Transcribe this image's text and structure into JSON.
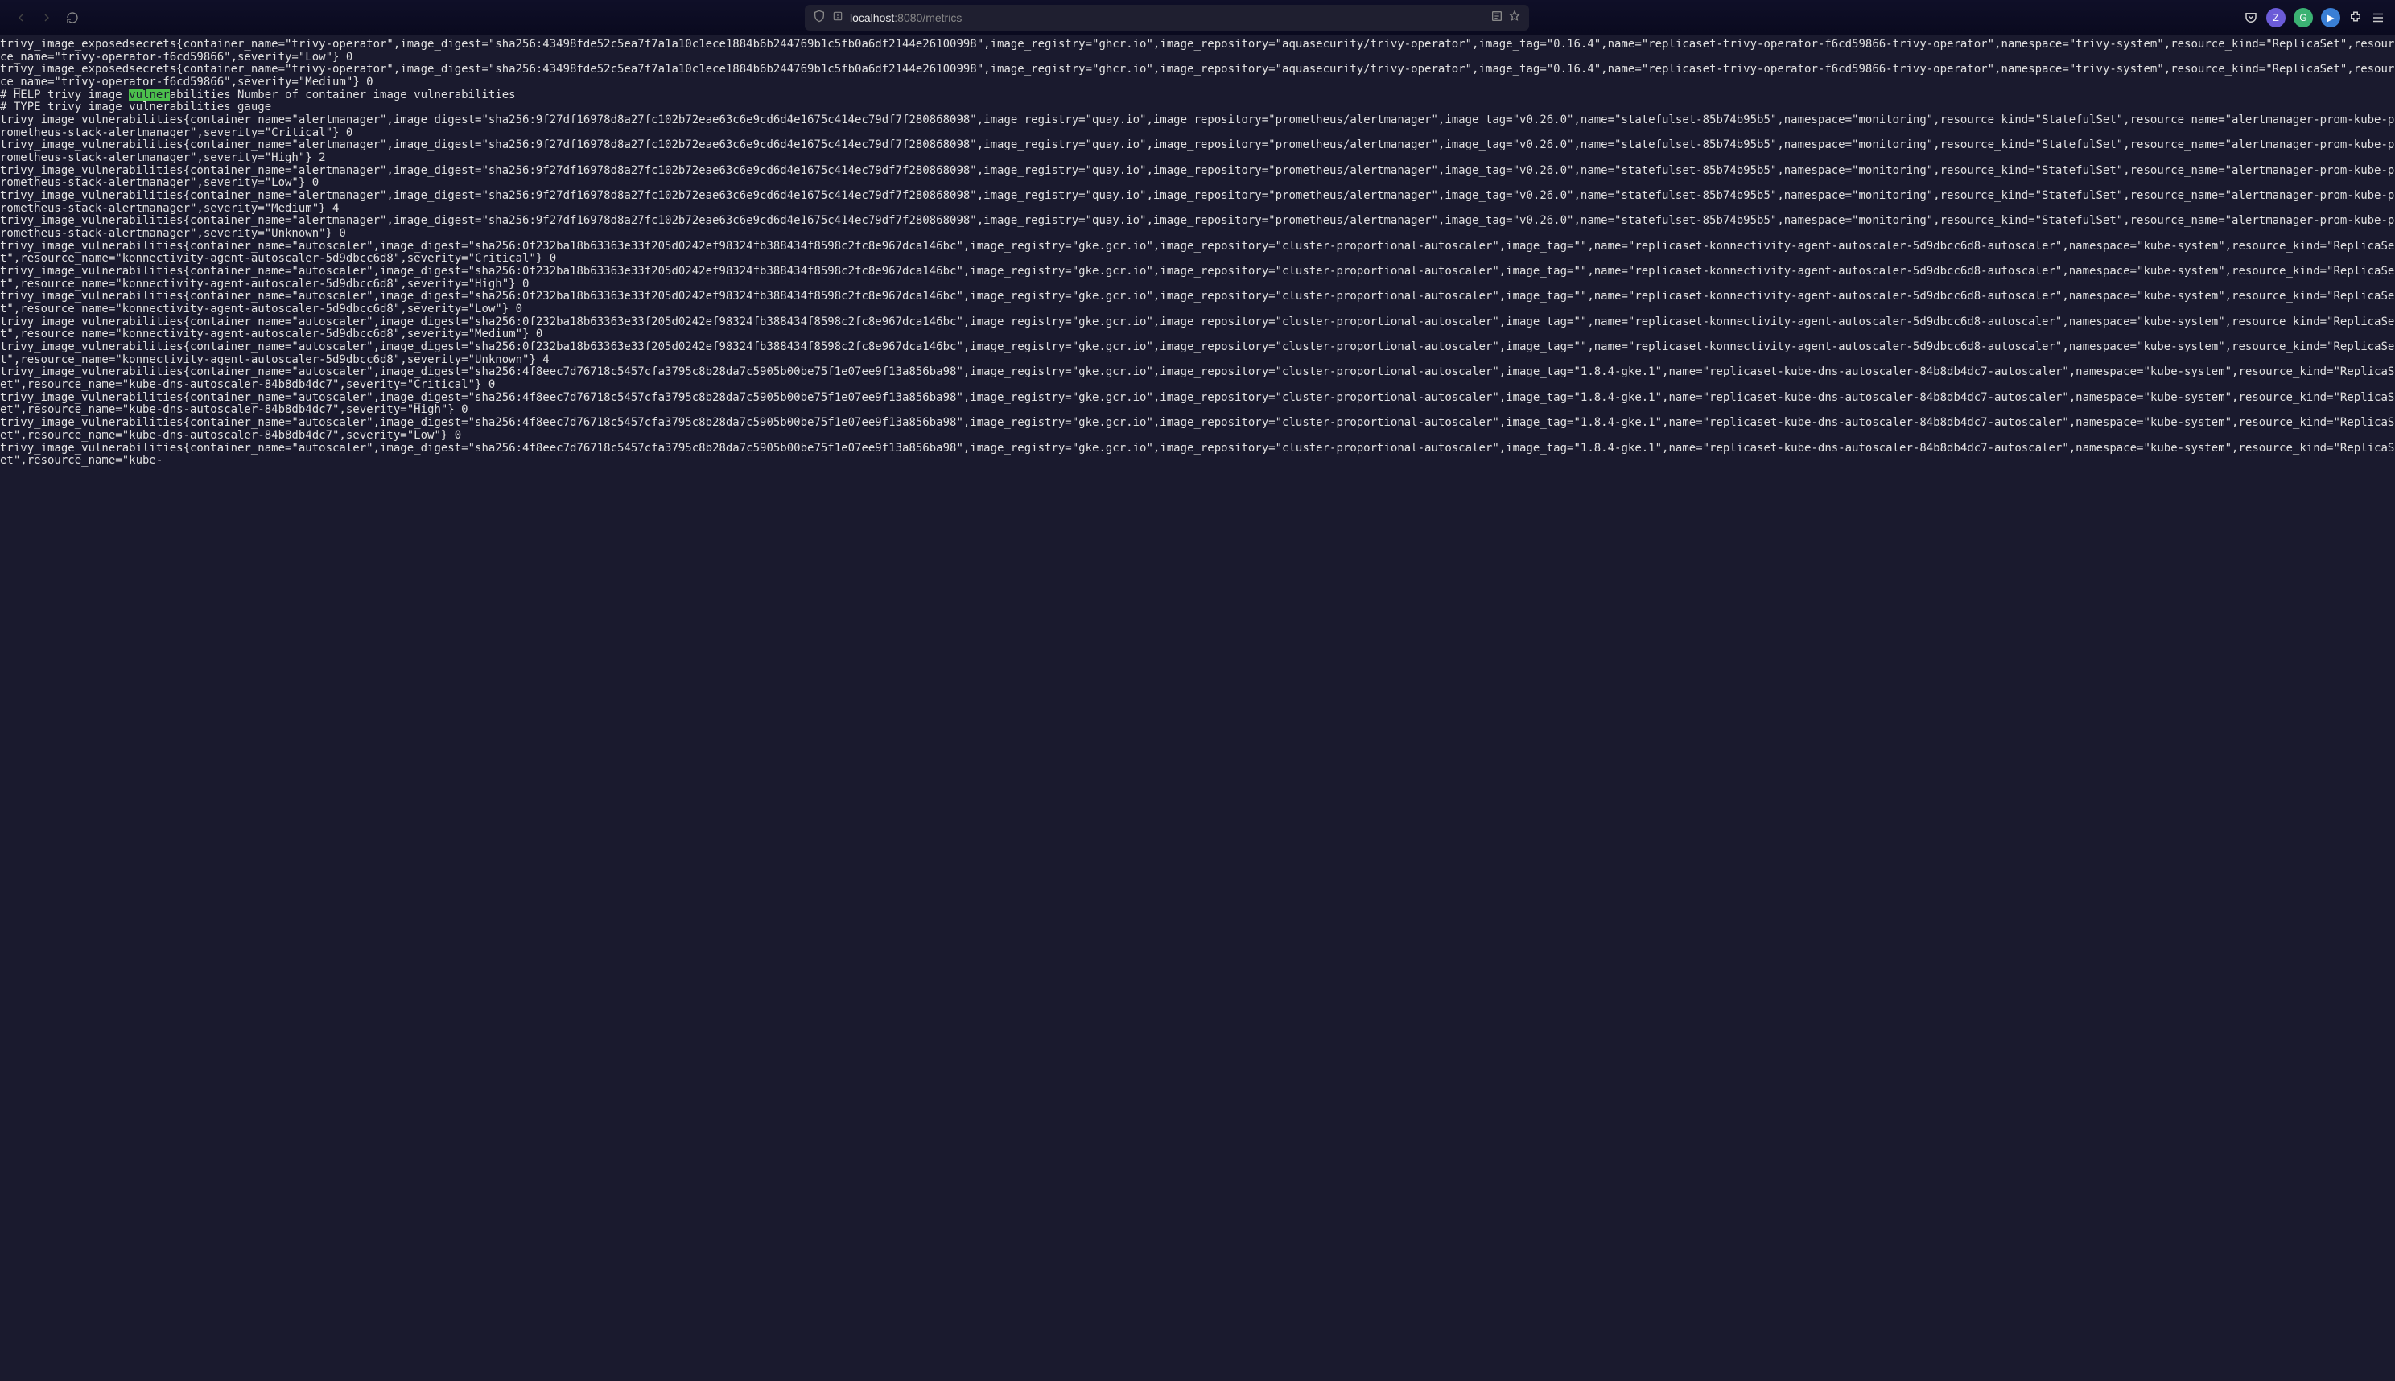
{
  "browser": {
    "url_host": "localhost",
    "url_port": ":8080",
    "url_path": "/metrics",
    "pill1_letter": "Z",
    "pill2_letter": "G",
    "pill3_symbol": "▶"
  },
  "highlight": "vulner",
  "metrics_lines": [
    "trivy_image_exposedsecrets{container_name=\"trivy-operator\",image_digest=\"sha256:43498fde52c5ea7f7a1a10c1ece1884b6b244769b1c5fb0a6df2144e26100998\",image_registry=\"ghcr.io\",image_repository=\"aquasecurity/trivy-operator\",image_tag=\"0.16.4\",name=\"replicaset-trivy-operator-f6cd59866-trivy-operator\",namespace=\"trivy-system\",resource_kind=\"ReplicaSet\",resource_name=\"trivy-operator-f6cd59866\",severity=\"Low\"} 0",
    "trivy_image_exposedsecrets{container_name=\"trivy-operator\",image_digest=\"sha256:43498fde52c5ea7f7a1a10c1ece1884b6b244769b1c5fb0a6df2144e26100998\",image_registry=\"ghcr.io\",image_repository=\"aquasecurity/trivy-operator\",image_tag=\"0.16.4\",name=\"replicaset-trivy-operator-f6cd59866-trivy-operator\",namespace=\"trivy-system\",resource_kind=\"ReplicaSet\",resource_name=\"trivy-operator-f6cd59866\",severity=\"Medium\"} 0",
    "# HELP trivy_image_vulnerabilities Number of container image vulnerabilities",
    "# TYPE trivy_image_vulnerabilities gauge",
    "trivy_image_vulnerabilities{container_name=\"alertmanager\",image_digest=\"sha256:9f27df16978d8a27fc102b72eae63c6e9cd6d4e1675c414ec79df7f280868098\",image_registry=\"quay.io\",image_repository=\"prometheus/alertmanager\",image_tag=\"v0.26.0\",name=\"statefulset-85b74b95b5\",namespace=\"monitoring\",resource_kind=\"StatefulSet\",resource_name=\"alertmanager-prom-kube-prometheus-stack-alertmanager\",severity=\"Critical\"} 0",
    "trivy_image_vulnerabilities{container_name=\"alertmanager\",image_digest=\"sha256:9f27df16978d8a27fc102b72eae63c6e9cd6d4e1675c414ec79df7f280868098\",image_registry=\"quay.io\",image_repository=\"prometheus/alertmanager\",image_tag=\"v0.26.0\",name=\"statefulset-85b74b95b5\",namespace=\"monitoring\",resource_kind=\"StatefulSet\",resource_name=\"alertmanager-prom-kube-prometheus-stack-alertmanager\",severity=\"High\"} 2",
    "trivy_image_vulnerabilities{container_name=\"alertmanager\",image_digest=\"sha256:9f27df16978d8a27fc102b72eae63c6e9cd6d4e1675c414ec79df7f280868098\",image_registry=\"quay.io\",image_repository=\"prometheus/alertmanager\",image_tag=\"v0.26.0\",name=\"statefulset-85b74b95b5\",namespace=\"monitoring\",resource_kind=\"StatefulSet\",resource_name=\"alertmanager-prom-kube-prometheus-stack-alertmanager\",severity=\"Low\"} 0",
    "trivy_image_vulnerabilities{container_name=\"alertmanager\",image_digest=\"sha256:9f27df16978d8a27fc102b72eae63c6e9cd6d4e1675c414ec79df7f280868098\",image_registry=\"quay.io\",image_repository=\"prometheus/alertmanager\",image_tag=\"v0.26.0\",name=\"statefulset-85b74b95b5\",namespace=\"monitoring\",resource_kind=\"StatefulSet\",resource_name=\"alertmanager-prom-kube-prometheus-stack-alertmanager\",severity=\"Medium\"} 4",
    "trivy_image_vulnerabilities{container_name=\"alertmanager\",image_digest=\"sha256:9f27df16978d8a27fc102b72eae63c6e9cd6d4e1675c414ec79df7f280868098\",image_registry=\"quay.io\",image_repository=\"prometheus/alertmanager\",image_tag=\"v0.26.0\",name=\"statefulset-85b74b95b5\",namespace=\"monitoring\",resource_kind=\"StatefulSet\",resource_name=\"alertmanager-prom-kube-prometheus-stack-alertmanager\",severity=\"Unknown\"} 0",
    "trivy_image_vulnerabilities{container_name=\"autoscaler\",image_digest=\"sha256:0f232ba18b63363e33f205d0242ef98324fb388434f8598c2fc8e967dca146bc\",image_registry=\"gke.gcr.io\",image_repository=\"cluster-proportional-autoscaler\",image_tag=\"\",name=\"replicaset-konnectivity-agent-autoscaler-5d9dbcc6d8-autoscaler\",namespace=\"kube-system\",resource_kind=\"ReplicaSet\",resource_name=\"konnectivity-agent-autoscaler-5d9dbcc6d8\",severity=\"Critical\"} 0",
    "trivy_image_vulnerabilities{container_name=\"autoscaler\",image_digest=\"sha256:0f232ba18b63363e33f205d0242ef98324fb388434f8598c2fc8e967dca146bc\",image_registry=\"gke.gcr.io\",image_repository=\"cluster-proportional-autoscaler\",image_tag=\"\",name=\"replicaset-konnectivity-agent-autoscaler-5d9dbcc6d8-autoscaler\",namespace=\"kube-system\",resource_kind=\"ReplicaSet\",resource_name=\"konnectivity-agent-autoscaler-5d9dbcc6d8\",severity=\"High\"} 0",
    "trivy_image_vulnerabilities{container_name=\"autoscaler\",image_digest=\"sha256:0f232ba18b63363e33f205d0242ef98324fb388434f8598c2fc8e967dca146bc\",image_registry=\"gke.gcr.io\",image_repository=\"cluster-proportional-autoscaler\",image_tag=\"\",name=\"replicaset-konnectivity-agent-autoscaler-5d9dbcc6d8-autoscaler\",namespace=\"kube-system\",resource_kind=\"ReplicaSet\",resource_name=\"konnectivity-agent-autoscaler-5d9dbcc6d8\",severity=\"Low\"} 0",
    "trivy_image_vulnerabilities{container_name=\"autoscaler\",image_digest=\"sha256:0f232ba18b63363e33f205d0242ef98324fb388434f8598c2fc8e967dca146bc\",image_registry=\"gke.gcr.io\",image_repository=\"cluster-proportional-autoscaler\",image_tag=\"\",name=\"replicaset-konnectivity-agent-autoscaler-5d9dbcc6d8-autoscaler\",namespace=\"kube-system\",resource_kind=\"ReplicaSet\",resource_name=\"konnectivity-agent-autoscaler-5d9dbcc6d8\",severity=\"Medium\"} 0",
    "trivy_image_vulnerabilities{container_name=\"autoscaler\",image_digest=\"sha256:0f232ba18b63363e33f205d0242ef98324fb388434f8598c2fc8e967dca146bc\",image_registry=\"gke.gcr.io\",image_repository=\"cluster-proportional-autoscaler\",image_tag=\"\",name=\"replicaset-konnectivity-agent-autoscaler-5d9dbcc6d8-autoscaler\",namespace=\"kube-system\",resource_kind=\"ReplicaSet\",resource_name=\"konnectivity-agent-autoscaler-5d9dbcc6d8\",severity=\"Unknown\"} 4",
    "trivy_image_vulnerabilities{container_name=\"autoscaler\",image_digest=\"sha256:4f8eec7d76718c5457cfa3795c8b28da7c5905b00be75f1e07ee9f13a856ba98\",image_registry=\"gke.gcr.io\",image_repository=\"cluster-proportional-autoscaler\",image_tag=\"1.8.4-gke.1\",name=\"replicaset-kube-dns-autoscaler-84b8db4dc7-autoscaler\",namespace=\"kube-system\",resource_kind=\"ReplicaSet\",resource_name=\"kube-dns-autoscaler-84b8db4dc7\",severity=\"Critical\"} 0",
    "trivy_image_vulnerabilities{container_name=\"autoscaler\",image_digest=\"sha256:4f8eec7d76718c5457cfa3795c8b28da7c5905b00be75f1e07ee9f13a856ba98\",image_registry=\"gke.gcr.io\",image_repository=\"cluster-proportional-autoscaler\",image_tag=\"1.8.4-gke.1\",name=\"replicaset-kube-dns-autoscaler-84b8db4dc7-autoscaler\",namespace=\"kube-system\",resource_kind=\"ReplicaSet\",resource_name=\"kube-dns-autoscaler-84b8db4dc7\",severity=\"High\"} 0",
    "trivy_image_vulnerabilities{container_name=\"autoscaler\",image_digest=\"sha256:4f8eec7d76718c5457cfa3795c8b28da7c5905b00be75f1e07ee9f13a856ba98\",image_registry=\"gke.gcr.io\",image_repository=\"cluster-proportional-autoscaler\",image_tag=\"1.8.4-gke.1\",name=\"replicaset-kube-dns-autoscaler-84b8db4dc7-autoscaler\",namespace=\"kube-system\",resource_kind=\"ReplicaSet\",resource_name=\"kube-dns-autoscaler-84b8db4dc7\",severity=\"Low\"} 0",
    "trivy_image_vulnerabilities{container_name=\"autoscaler\",image_digest=\"sha256:4f8eec7d76718c5457cfa3795c8b28da7c5905b00be75f1e07ee9f13a856ba98\",image_registry=\"gke.gcr.io\",image_repository=\"cluster-proportional-autoscaler\",image_tag=\"1.8.4-gke.1\",name=\"replicaset-kube-dns-autoscaler-84b8db4dc7-autoscaler\",namespace=\"kube-system\",resource_kind=\"ReplicaSet\",resource_name=\"kube-"
  ]
}
